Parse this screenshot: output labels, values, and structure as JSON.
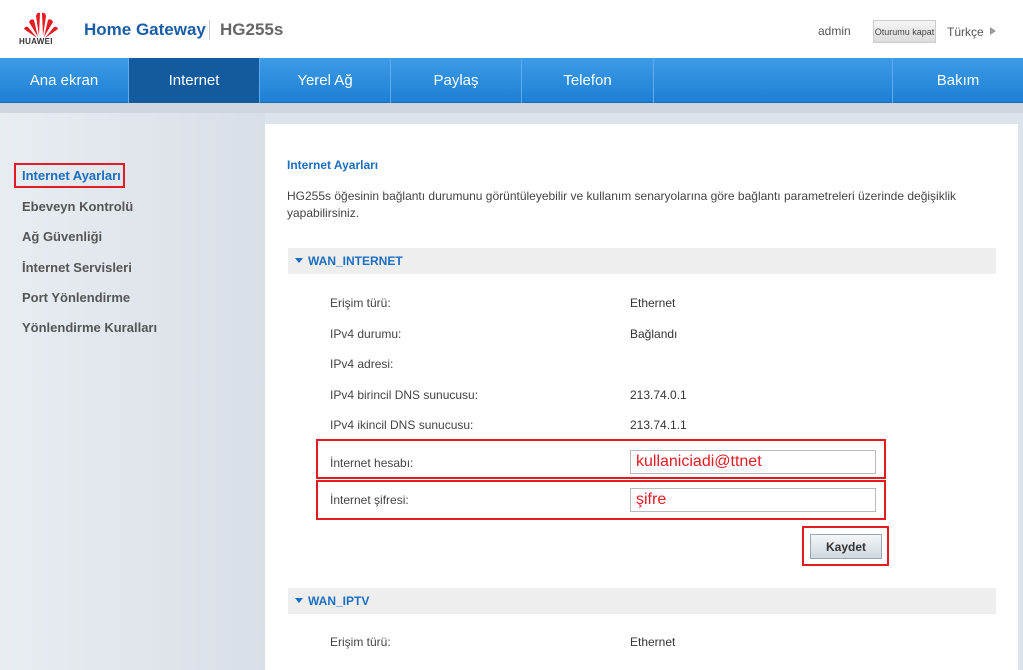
{
  "header": {
    "logo_text": "HUAWEI",
    "brand": "Home Gateway",
    "model": "HG255s",
    "user": "admin",
    "logout_label": "Oturumu kapat",
    "language": "Türkçe"
  },
  "nav": {
    "items": [
      {
        "label": "Ana ekran"
      },
      {
        "label": "Internet"
      },
      {
        "label": "Yerel Ağ"
      },
      {
        "label": "Paylaş"
      },
      {
        "label": "Telefon"
      },
      {
        "label": "Bakım"
      }
    ],
    "active": "Internet"
  },
  "sidebar": {
    "items": [
      {
        "label": "Internet Ayarları"
      },
      {
        "label": "Ebeveyn Kontrolü"
      },
      {
        "label": "Ağ Güvenliği"
      },
      {
        "label": "İnternet Servisleri"
      },
      {
        "label": "Port Yönlendirme"
      },
      {
        "label": "Yönlendirme Kuralları"
      }
    ]
  },
  "main": {
    "title": "Internet Ayarları",
    "description": "HG255s öğesinin bağlantı durumunu görüntüleyebilir ve kullanım senaryolarına göre bağlantı parametreleri üzerinde değişiklik yapabilirsiniz.",
    "wan_internet": {
      "title": "WAN_INTERNET",
      "rows": [
        {
          "label": "Erişim türü:",
          "value": "Ethernet"
        },
        {
          "label": "IPv4 durumu:",
          "value": "Bağlandı"
        },
        {
          "label": "IPv4 adresi:",
          "value": ""
        },
        {
          "label": "IPv4 birincil DNS sunucusu:",
          "value": "213.74.0.1"
        },
        {
          "label": "IPv4 ikincil DNS sunucusu:",
          "value": "213.74.1.1"
        }
      ],
      "account_label": "İnternet hesabı:",
      "account_value": "kullaniciadi@ttnet",
      "password_label": "İnternet şifresi:",
      "password_value": "şifre",
      "save_label": "Kaydet"
    },
    "wan_iptv": {
      "title": "WAN_IPTV",
      "rows": [
        {
          "label": "Erişim türü:",
          "value": "Ethernet"
        }
      ]
    }
  },
  "colors": {
    "accent": "#1b6ec2",
    "nav": "#2a8ddf",
    "highlight": "#e31b23"
  }
}
